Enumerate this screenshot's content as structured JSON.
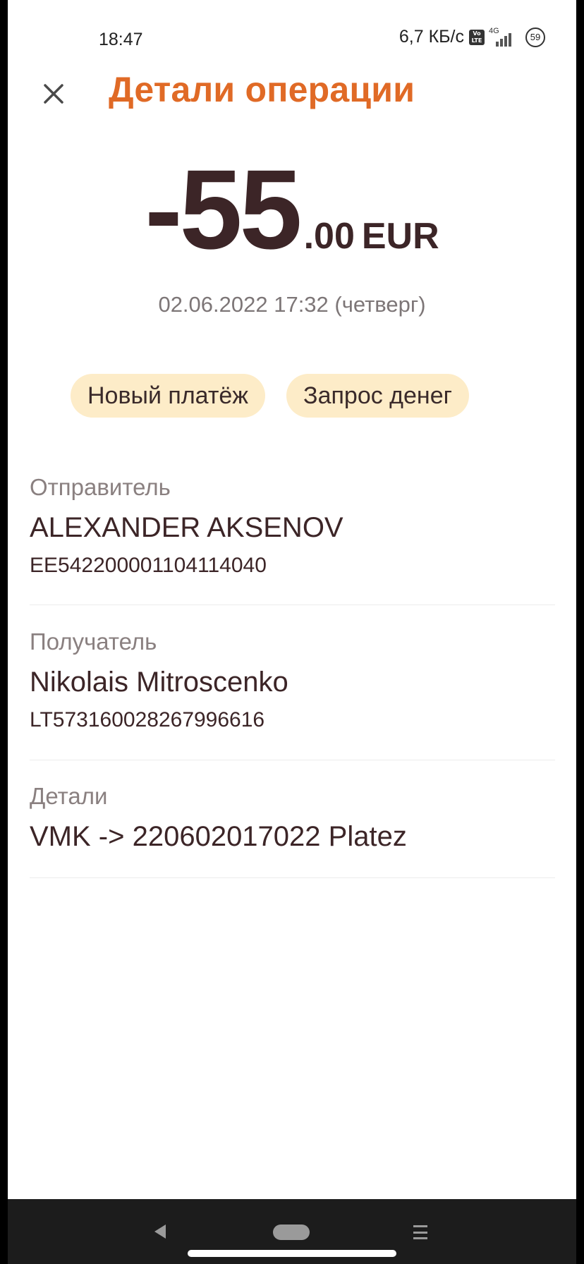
{
  "status_bar": {
    "time": "18:47",
    "network_speed": "6,7 КБ/с",
    "volte": "Vo LTE",
    "network_type": "4G",
    "battery": "59"
  },
  "header": {
    "close_icon": "close-icon",
    "title": "Детали операции"
  },
  "amount": {
    "sign_and_whole": "-55",
    "fraction": ".00",
    "currency": "EUR"
  },
  "date": "02.06.2022 17:32 (четверг)",
  "actions": {
    "new_payment": "Новый платёж",
    "request_money": "Запрос денег"
  },
  "sender": {
    "label": "Отправитель",
    "name": "ALEXANDER AKSENOV",
    "account": "EE542200001104114040"
  },
  "recipient": {
    "label": "Получатель",
    "name": "Nikolais Mitroscenko",
    "account": "LT573160028267996616"
  },
  "details": {
    "label": "Детали",
    "text": "VMK -> 220602017022 Platez"
  },
  "colors": {
    "accent": "#e06a26",
    "pill_background": "#fdecc8",
    "text_primary": "#3c2527",
    "text_secondary": "#8a8080"
  }
}
